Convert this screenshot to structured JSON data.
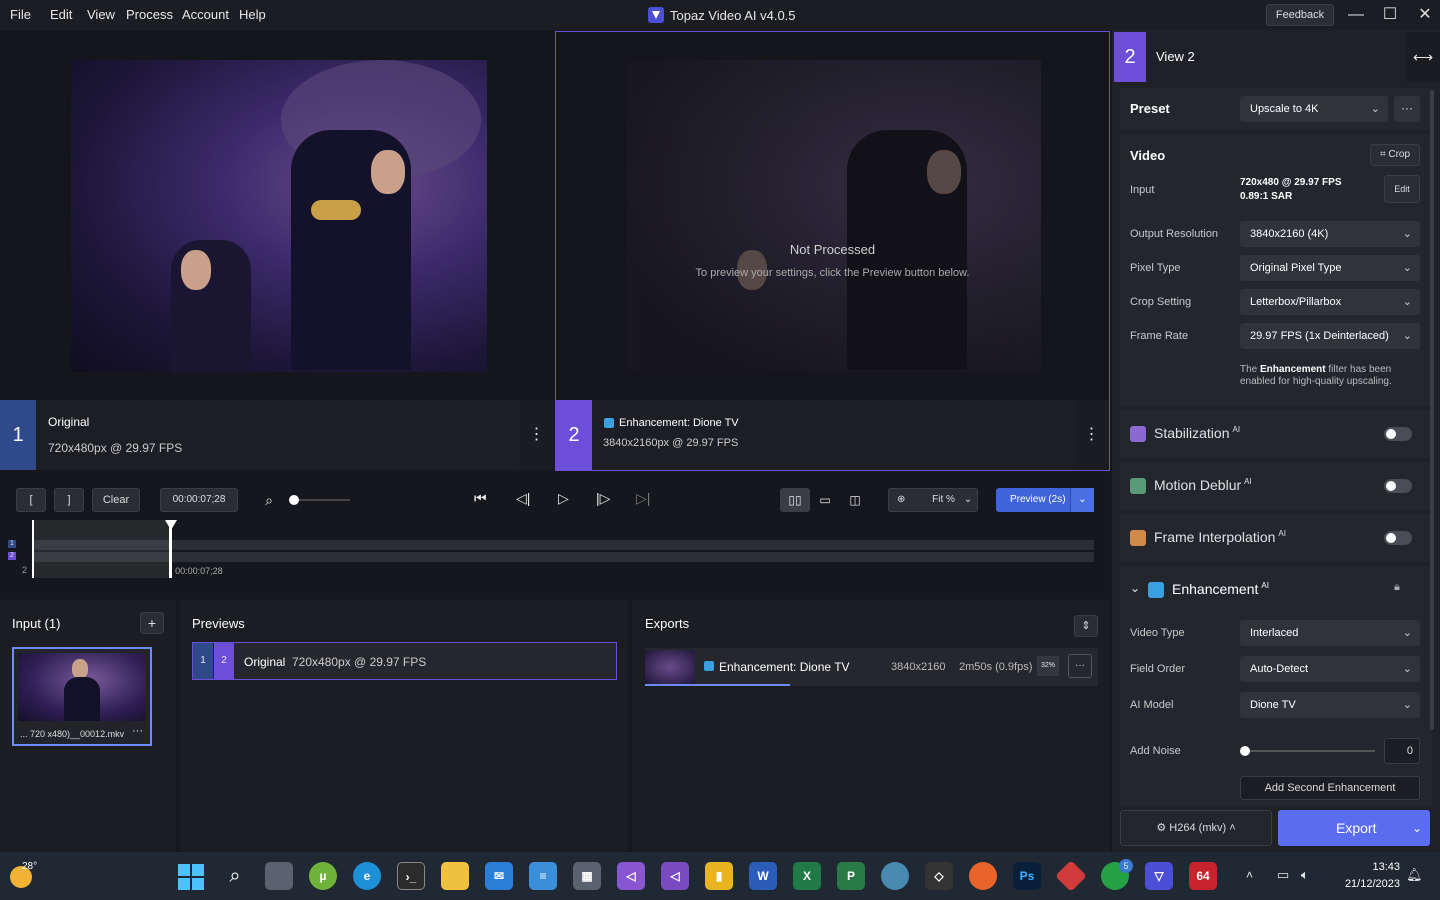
{
  "menu": [
    "File",
    "Edit",
    "View",
    "Process",
    "Account",
    "Help"
  ],
  "app_title": "Topaz Video AI  v4.0.5",
  "feedback_label": "Feedback",
  "viewer1": {
    "num": "1",
    "title": "Original",
    "info": "720x480px @ 29.97 FPS"
  },
  "viewer2": {
    "num": "2",
    "title": "Enhancement: Dione TV",
    "info": "3840x2160px @ 29.97 FPS",
    "not_processed": "Not Processed",
    "hint": "To preview your settings, click the Preview button below."
  },
  "controls": {
    "in_mark": "[",
    "out_mark": "]",
    "clear": "Clear",
    "timecode": "00:00:07;28",
    "zoom": "Fit %",
    "preview": "Preview (2s)",
    "playhead_time": "00:00:07;28",
    "track1": "1",
    "track2": "2",
    "track2_row_label": "2",
    "playhead_fraction": 0.131
  },
  "right": {
    "view_num": "2",
    "view_title": "View 2",
    "preset_label": "Preset",
    "preset_value": "Upscale to 4K",
    "video_label": "Video",
    "crop_label": "Crop",
    "input_label": "Input",
    "input_res": "720x480 @ 29.97 FPS",
    "input_sar": "0.89:1 SAR",
    "edit_label": "Edit",
    "output_label": "Output Resolution",
    "output_value": "3840x2160 (4K)",
    "pixel_label": "Pixel Type",
    "pixel_value": "Original Pixel Type",
    "cropset_label": "Crop Setting",
    "cropset_value": "Letterbox/Pillarbox",
    "fps_label": "Frame Rate",
    "fps_value": "29.97 FPS (1x Deinterlaced)",
    "note_pre": "The ",
    "note_bold": "Enhancement",
    "note_post": " filter has been enabled for high-quality upscaling.",
    "stab": "Stabilization",
    "deblur": "Motion Deblur",
    "interp": "Frame Interpolation",
    "ai": "AI",
    "enh": "Enhancement",
    "vtype_label": "Video Type",
    "vtype_value": "Interlaced",
    "field_label": "Field Order",
    "field_value": "Auto-Detect",
    "model_label": "AI Model",
    "model_value": "Dione TV",
    "noise_label": "Add Noise",
    "noise_value": "0",
    "noise_fraction": 0.0,
    "second_enh": "Add Second Enhancement",
    "codec": "H264 (mkv)",
    "export": "Export"
  },
  "input_panel": {
    "title": "Input (1)",
    "file": "... 720 x480)__00012.mkv"
  },
  "previews_panel": {
    "title": "Previews",
    "n1": "1",
    "n2": "2",
    "name": "Original",
    "info": "720x480px @ 29.97 FPS"
  },
  "exports_panel": {
    "title": "Exports",
    "name": "Enhancement: Dione TV",
    "res": "3840x2160",
    "eta": "2m50s (0.9fps)",
    "pct": "32%",
    "progress_fraction": 0.32
  },
  "taskbar": {
    "weather": "28°",
    "time": "13:43",
    "date": "21/12/2023",
    "badge": "5",
    "app64": "64"
  },
  "colors": {
    "accent": "#6b4fd8",
    "export": "#5a6cf0",
    "preview": "#3f63d8",
    "viewer1": "#2f4a8a"
  }
}
